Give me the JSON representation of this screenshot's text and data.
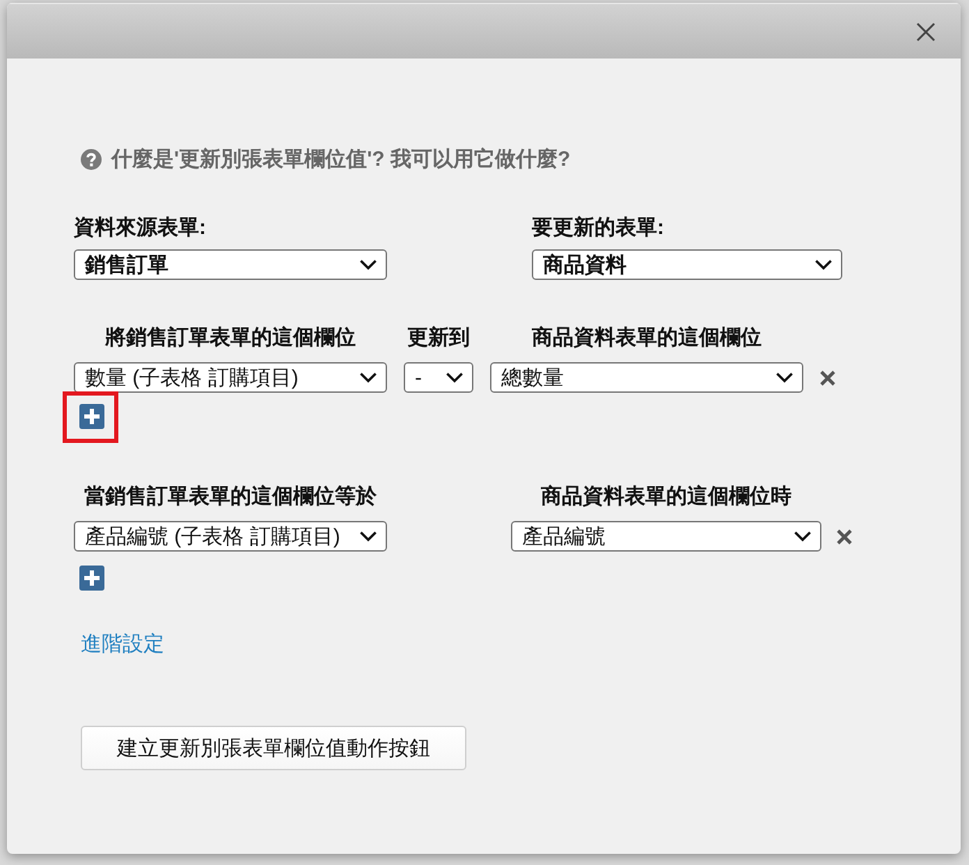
{
  "help_link": {
    "text": "什麼是'更新別張表單欄位值'? 我可以用它做什麼?"
  },
  "source_form": {
    "label": "資料來源表單:",
    "value": "銷售訂單"
  },
  "target_form": {
    "label": "要更新的表單:",
    "value": "商品資料"
  },
  "update_mapping": {
    "columns": [
      "將銷售訂單表單的這個欄位",
      "更新到",
      "商品資料表單的這個欄位"
    ],
    "rows": [
      {
        "source_field": "數量 (子表格 訂購項目)",
        "operator": "-",
        "target_field": "總數量"
      }
    ],
    "add_button": {
      "highlighted": true
    }
  },
  "match_condition": {
    "columns": [
      "當銷售訂單表單的這個欄位等於",
      "商品資料表單的這個欄位時"
    ],
    "rows": [
      {
        "source_field": "產品編號 (子表格 訂購項目)",
        "target_field": "產品編號"
      }
    ],
    "add_button": {
      "highlighted": false
    }
  },
  "advanced_link": "進階設定",
  "create_button": "建立更新別張表單欄位值動作按鈕"
}
